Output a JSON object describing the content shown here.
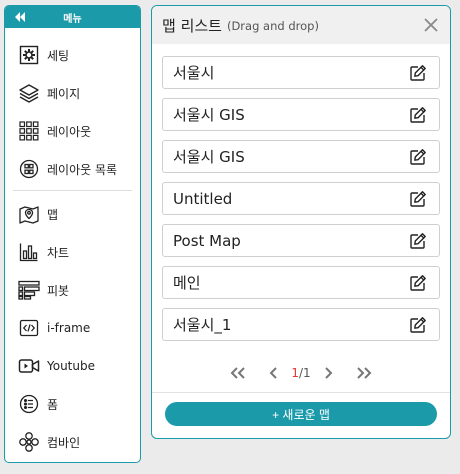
{
  "sidebar": {
    "title": "메뉴",
    "items": [
      {
        "label": "세팅",
        "icon": "gear-icon"
      },
      {
        "label": "페이지",
        "icon": "layers-icon"
      },
      {
        "label": "레이아웃",
        "icon": "grid-icon"
      },
      {
        "label": "레이아웃 목록",
        "icon": "layout-list-icon"
      },
      {
        "label": "맵",
        "icon": "map-icon"
      },
      {
        "label": "차트",
        "icon": "bar-chart-icon"
      },
      {
        "label": "피봇",
        "icon": "pivot-icon"
      },
      {
        "label": "i-frame",
        "icon": "code-icon"
      },
      {
        "label": "Youtube",
        "icon": "video-icon"
      },
      {
        "label": "폼",
        "icon": "form-icon"
      },
      {
        "label": "컴바인",
        "icon": "combine-icon"
      }
    ]
  },
  "panel": {
    "title": "맵 리스트",
    "hint": "(Drag and drop)",
    "maps": [
      "서울시",
      "서울시 GIS",
      "서울시 GIS",
      "Untitled",
      "Post Map",
      "메인",
      "서울시_1"
    ],
    "pager": {
      "current": "1",
      "total": "/1"
    },
    "add_label": "+ 새로운 맵"
  },
  "colors": {
    "accent": "#1b9aaa",
    "current_page": "#e53935"
  }
}
